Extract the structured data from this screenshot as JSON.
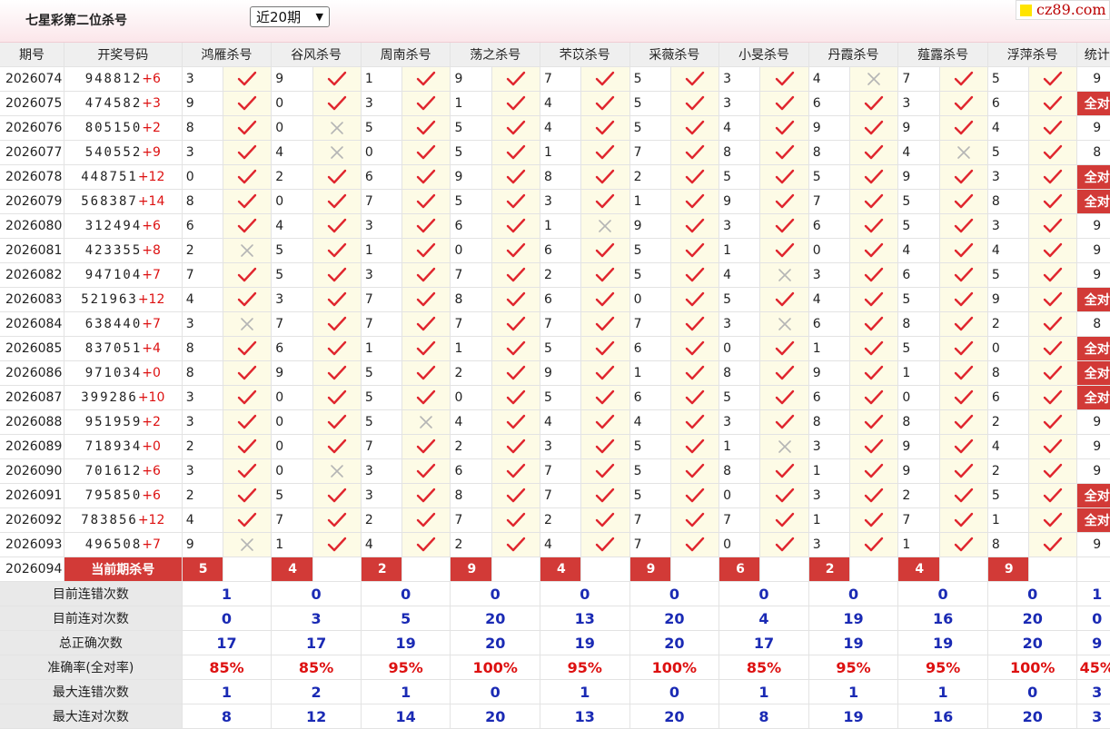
{
  "page_title": "七星彩第二位杀号",
  "period_select": "近20期",
  "site_logo": "cz89.com",
  "headers": [
    "期号",
    "开奖号码",
    "鸿雁杀号",
    "谷风杀号",
    "周南杀号",
    "荡之杀号",
    "芣苡杀号",
    "采薇杀号",
    "小旻杀号",
    "丹霞杀号",
    "薤露杀号",
    "浮萍杀号",
    "统计"
  ],
  "full_label": "全对",
  "rows": [
    {
      "period": "2026074",
      "draw": "948812",
      "bonus": "+6",
      "kills": [
        3,
        9,
        1,
        9,
        7,
        5,
        3,
        4,
        7,
        5
      ],
      "ok": [
        1,
        1,
        1,
        1,
        1,
        1,
        1,
        0,
        1,
        1
      ],
      "stat": "9"
    },
    {
      "period": "2026075",
      "draw": "474582",
      "bonus": "+3",
      "kills": [
        9,
        0,
        3,
        1,
        4,
        5,
        3,
        6,
        3,
        6
      ],
      "ok": [
        1,
        1,
        1,
        1,
        1,
        1,
        1,
        1,
        1,
        1
      ],
      "stat": "全对"
    },
    {
      "period": "2026076",
      "draw": "805150",
      "bonus": "+2",
      "kills": [
        8,
        0,
        5,
        5,
        4,
        5,
        4,
        9,
        9,
        4
      ],
      "ok": [
        1,
        0,
        1,
        1,
        1,
        1,
        1,
        1,
        1,
        1
      ],
      "stat": "9"
    },
    {
      "period": "2026077",
      "draw": "540552",
      "bonus": "+9",
      "kills": [
        3,
        4,
        0,
        5,
        1,
        7,
        8,
        8,
        4,
        5
      ],
      "ok": [
        1,
        0,
        1,
        1,
        1,
        1,
        1,
        1,
        0,
        1
      ],
      "stat": "8"
    },
    {
      "period": "2026078",
      "draw": "448751",
      "bonus": "+12",
      "kills": [
        0,
        2,
        6,
        9,
        8,
        2,
        5,
        5,
        9,
        3
      ],
      "ok": [
        1,
        1,
        1,
        1,
        1,
        1,
        1,
        1,
        1,
        1
      ],
      "stat": "全对"
    },
    {
      "period": "2026079",
      "draw": "568387",
      "bonus": "+14",
      "kills": [
        8,
        0,
        7,
        5,
        3,
        1,
        9,
        7,
        5,
        8
      ],
      "ok": [
        1,
        1,
        1,
        1,
        1,
        1,
        1,
        1,
        1,
        1
      ],
      "stat": "全对"
    },
    {
      "period": "2026080",
      "draw": "312494",
      "bonus": "+6",
      "kills": [
        6,
        4,
        3,
        6,
        1,
        9,
        3,
        6,
        5,
        3
      ],
      "ok": [
        1,
        1,
        1,
        1,
        0,
        1,
        1,
        1,
        1,
        1
      ],
      "stat": "9"
    },
    {
      "period": "2026081",
      "draw": "423355",
      "bonus": "+8",
      "kills": [
        2,
        5,
        1,
        0,
        6,
        5,
        1,
        0,
        4,
        4
      ],
      "ok": [
        0,
        1,
        1,
        1,
        1,
        1,
        1,
        1,
        1,
        1
      ],
      "stat": "9"
    },
    {
      "period": "2026082",
      "draw": "947104",
      "bonus": "+7",
      "kills": [
        7,
        5,
        3,
        7,
        2,
        5,
        4,
        3,
        6,
        5
      ],
      "ok": [
        1,
        1,
        1,
        1,
        1,
        1,
        0,
        1,
        1,
        1
      ],
      "stat": "9"
    },
    {
      "period": "2026083",
      "draw": "521963",
      "bonus": "+12",
      "kills": [
        4,
        3,
        7,
        8,
        6,
        0,
        5,
        4,
        5,
        9
      ],
      "ok": [
        1,
        1,
        1,
        1,
        1,
        1,
        1,
        1,
        1,
        1
      ],
      "stat": "全对"
    },
    {
      "period": "2026084",
      "draw": "638440",
      "bonus": "+7",
      "kills": [
        3,
        7,
        7,
        7,
        7,
        7,
        3,
        6,
        8,
        2
      ],
      "ok": [
        0,
        1,
        1,
        1,
        1,
        1,
        0,
        1,
        1,
        1
      ],
      "stat": "8"
    },
    {
      "period": "2026085",
      "draw": "837051",
      "bonus": "+4",
      "kills": [
        8,
        6,
        1,
        1,
        5,
        6,
        0,
        1,
        5,
        0
      ],
      "ok": [
        1,
        1,
        1,
        1,
        1,
        1,
        1,
        1,
        1,
        1
      ],
      "stat": "全对"
    },
    {
      "period": "2026086",
      "draw": "971034",
      "bonus": "+0",
      "kills": [
        8,
        9,
        5,
        2,
        9,
        1,
        8,
        9,
        1,
        8
      ],
      "ok": [
        1,
        1,
        1,
        1,
        1,
        1,
        1,
        1,
        1,
        1
      ],
      "stat": "全对"
    },
    {
      "period": "2026087",
      "draw": "399286",
      "bonus": "+10",
      "kills": [
        3,
        0,
        5,
        0,
        5,
        6,
        5,
        6,
        0,
        6
      ],
      "ok": [
        1,
        1,
        1,
        1,
        1,
        1,
        1,
        1,
        1,
        1
      ],
      "stat": "全对"
    },
    {
      "period": "2026088",
      "draw": "951959",
      "bonus": "+2",
      "kills": [
        3,
        0,
        5,
        4,
        4,
        4,
        3,
        8,
        8,
        2
      ],
      "ok": [
        1,
        1,
        0,
        1,
        1,
        1,
        1,
        1,
        1,
        1
      ],
      "stat": "9"
    },
    {
      "period": "2026089",
      "draw": "718934",
      "bonus": "+0",
      "kills": [
        2,
        0,
        7,
        2,
        3,
        5,
        1,
        3,
        9,
        4
      ],
      "ok": [
        1,
        1,
        1,
        1,
        1,
        1,
        0,
        1,
        1,
        1
      ],
      "stat": "9"
    },
    {
      "period": "2026090",
      "draw": "701612",
      "bonus": "+6",
      "kills": [
        3,
        0,
        3,
        6,
        7,
        5,
        8,
        1,
        9,
        2
      ],
      "ok": [
        1,
        0,
        1,
        1,
        1,
        1,
        1,
        1,
        1,
        1
      ],
      "stat": "9"
    },
    {
      "period": "2026091",
      "draw": "795850",
      "bonus": "+6",
      "kills": [
        2,
        5,
        3,
        8,
        7,
        5,
        0,
        3,
        2,
        5
      ],
      "ok": [
        1,
        1,
        1,
        1,
        1,
        1,
        1,
        1,
        1,
        1
      ],
      "stat": "全对"
    },
    {
      "period": "2026092",
      "draw": "783856",
      "bonus": "+12",
      "kills": [
        4,
        7,
        2,
        7,
        2,
        7,
        7,
        1,
        7,
        1
      ],
      "ok": [
        1,
        1,
        1,
        1,
        1,
        1,
        1,
        1,
        1,
        1
      ],
      "stat": "全对"
    },
    {
      "period": "2026093",
      "draw": "496508",
      "bonus": "+7",
      "kills": [
        9,
        1,
        4,
        2,
        4,
        7,
        0,
        3,
        1,
        8
      ],
      "ok": [
        0,
        1,
        1,
        1,
        1,
        1,
        1,
        1,
        1,
        1
      ],
      "stat": "9"
    }
  ],
  "current": {
    "period": "2026094",
    "label": "当前期杀号",
    "kills": [
      "5",
      "4",
      "2",
      "9",
      "4",
      "9",
      "6",
      "2",
      "4",
      "9"
    ]
  },
  "stats": [
    {
      "label": "目前连错次数",
      "values": [
        "1",
        "0",
        "0",
        "0",
        "0",
        "0",
        "0",
        "0",
        "0",
        "0"
      ],
      "total": "1",
      "red": false
    },
    {
      "label": "目前连对次数",
      "values": [
        "0",
        "3",
        "5",
        "20",
        "13",
        "20",
        "4",
        "19",
        "16",
        "20"
      ],
      "total": "0",
      "red": false
    },
    {
      "label": "总正确次数",
      "values": [
        "17",
        "17",
        "19",
        "20",
        "19",
        "20",
        "17",
        "19",
        "19",
        "20"
      ],
      "total": "9",
      "red": false
    },
    {
      "label": "准确率(全对率)",
      "values": [
        "85%",
        "85%",
        "95%",
        "100%",
        "95%",
        "100%",
        "85%",
        "95%",
        "95%",
        "100%"
      ],
      "total": "45%",
      "red": true
    },
    {
      "label": "最大连错次数",
      "values": [
        "1",
        "2",
        "1",
        "0",
        "1",
        "0",
        "1",
        "1",
        "1",
        "0"
      ],
      "total": "3",
      "red": false
    },
    {
      "label": "最大连对次数",
      "values": [
        "8",
        "12",
        "14",
        "20",
        "13",
        "20",
        "8",
        "19",
        "16",
        "20"
      ],
      "total": "3",
      "red": false
    }
  ]
}
